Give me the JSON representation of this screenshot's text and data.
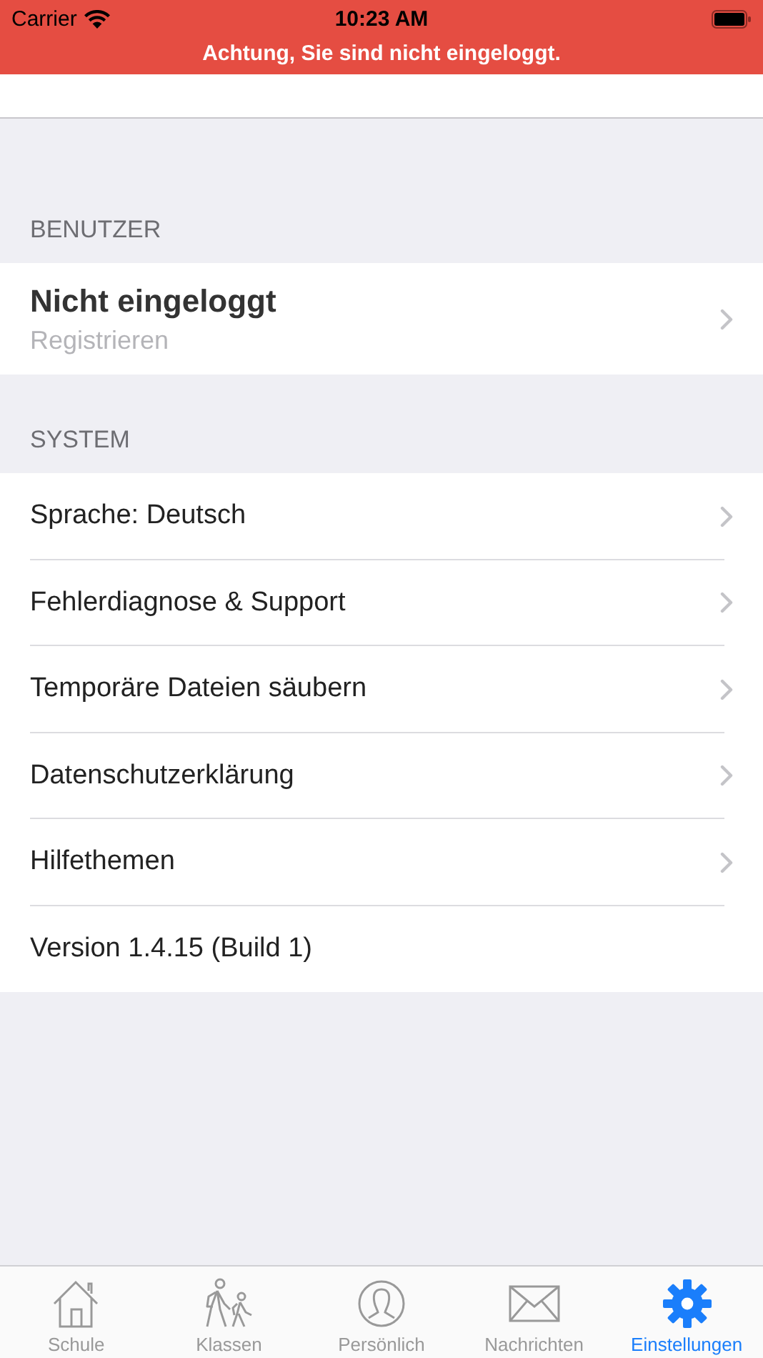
{
  "status_bar": {
    "carrier": "Carrier",
    "time": "10:23 AM"
  },
  "banner": {
    "text": "Achtung, Sie sind nicht eingeloggt."
  },
  "sections": [
    {
      "header": "BENUTZER",
      "rows": [
        {
          "kind": "account",
          "title": "Nicht eingeloggt",
          "subtitle": "Registrieren",
          "chevron": true
        }
      ]
    },
    {
      "header": "SYSTEM",
      "rows": [
        {
          "kind": "link",
          "title": "Sprache: Deutsch",
          "chevron": true
        },
        {
          "kind": "link",
          "title": "Fehlerdiagnose & Support",
          "chevron": true
        },
        {
          "kind": "link",
          "title": "Temporäre Dateien säubern",
          "chevron": true
        },
        {
          "kind": "link",
          "title": "Datenschutzerklärung",
          "chevron": true
        },
        {
          "kind": "link",
          "title": "Hilfethemen",
          "chevron": true
        },
        {
          "kind": "info",
          "title": "Version 1.4.15 (Build 1)",
          "chevron": false
        }
      ]
    }
  ],
  "tabs": [
    {
      "label": "Schule",
      "selected": false
    },
    {
      "label": "Klassen",
      "selected": false
    },
    {
      "label": "Persönlich",
      "selected": false
    },
    {
      "label": "Nachrichten",
      "selected": false
    },
    {
      "label": "Einstellungen",
      "selected": true
    }
  ]
}
